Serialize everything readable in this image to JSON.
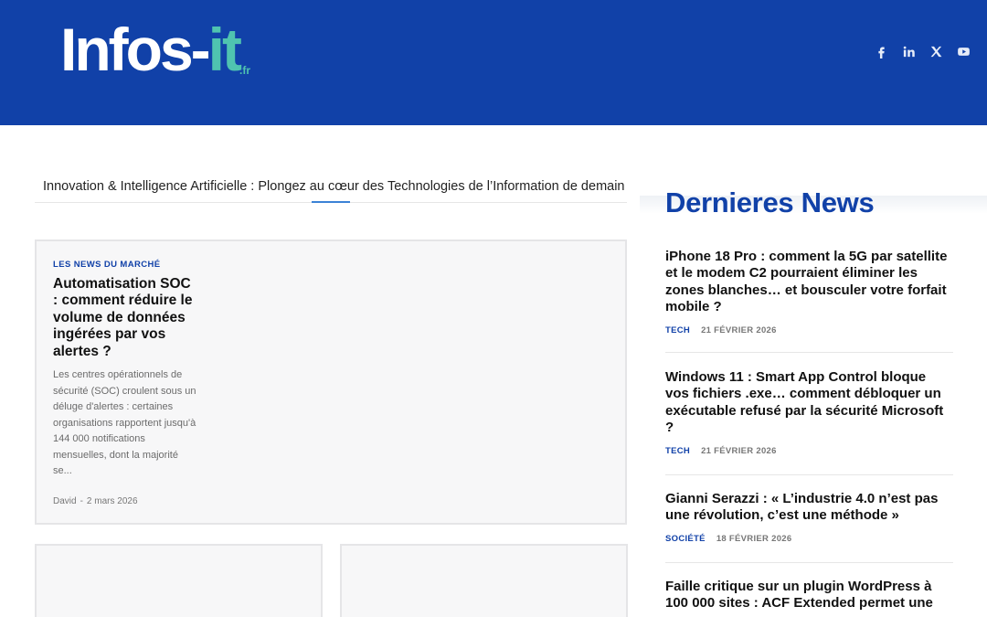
{
  "brand": {
    "logo_main": "Infos-",
    "logo_accent": "it",
    "logo_tld": ".fr",
    "colors": {
      "header": "#1141a8",
      "accent": "#4fc3b0",
      "link_blue": "#1141a8"
    }
  },
  "socials": [
    {
      "icon": "facebook-icon"
    },
    {
      "icon": "linkedin-icon"
    },
    {
      "icon": "x-icon"
    },
    {
      "icon": "youtube-icon"
    }
  ],
  "tagline": "Innovation & Intelligence Artificielle : Plongez au cœur des Technologies de l’Information de demain",
  "feature": {
    "category": "LES NEWS DU MARCHÉ",
    "title": "Automatisation SOC : comment réduire le volume de données ingérées par vos alertes ?",
    "excerpt": "Les centres opérationnels de sécurité (SOC) croulent sous un déluge d'alertes : certaines organisations rapportent jusqu'à 144 000 notifications mensuelles, dont la majorité se...",
    "author": "David",
    "separator": "-",
    "date": "2 mars 2026"
  },
  "sidebar": {
    "title": "Dernieres News",
    "items": [
      {
        "title": "iPhone 18 Pro : comment la 5G par satellite et le modem C2 pourraient éliminer les zones blanches… et bousculer votre forfait mobile ?",
        "category": "TECH",
        "date": "21 FÉVRIER 2026"
      },
      {
        "title": "Windows 11 : Smart App Control bloque vos fichiers .exe… comment débloquer un exécutable refusé par la sécurité Microsoft ?",
        "category": "TECH",
        "date": "21 FÉVRIER 2026"
      },
      {
        "title": "Gianni Serazzi : « L’industrie 4.0 n’est pas une révolution, c’est une méthode »",
        "category": "SOCIÉTÉ",
        "date": "18 FÉVRIER 2026"
      },
      {
        "title": "Faille critique sur un plugin WordPress à 100 000 sites : ACF Extended permet une",
        "category": "",
        "date": ""
      }
    ]
  }
}
